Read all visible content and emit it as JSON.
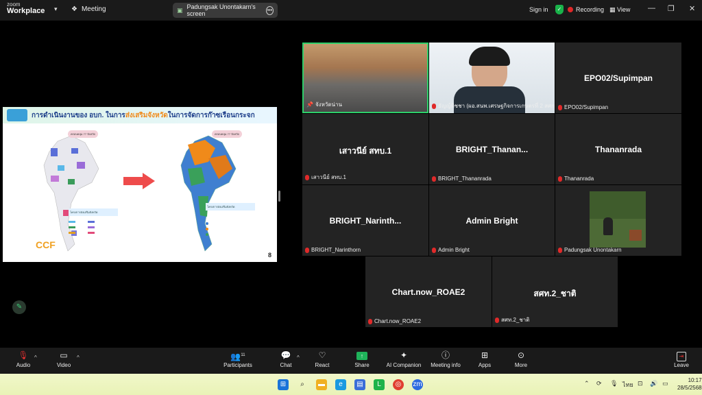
{
  "app": {
    "logo_line1": "zoom",
    "logo_line2": "Workplace",
    "meeting_label": "Meeting"
  },
  "share_banner": {
    "text": "Padungsak Unontakarn's screen"
  },
  "topbar": {
    "sign_in": "Sign in",
    "recording": "Recording",
    "view": "View"
  },
  "slide": {
    "title_pre": "การดำเนินงานของ อบก. ในการ",
    "title_hl": "ส่งเสริมจังหวัด",
    "title_post": "ในการจัดการก๊าซเรือนกระจก",
    "left_pill": "ครอบคลุม 77 จังหวัด",
    "right_pill": "ครอบคลุม 77 จังหวัด",
    "left_note": "โครงการส่งเสริมจังหวัด",
    "right_note": "โครงการส่งเสริมจังหวัด",
    "logo_text": "CCF",
    "page_number": "8"
  },
  "tiles": [
    {
      "name": "",
      "label": "จังหวัดน่าน",
      "muted": false,
      "pinned": true
    },
    {
      "name": "",
      "label": "ธัญญ์ทิชชา (ผอ.สนพ.เศรษฐกิจการเกษตรที่ 2 สศก.)",
      "muted": true
    },
    {
      "name": "EPO02/Supimpan",
      "label": "EPO02/Supimpan",
      "muted": true
    },
    {
      "name": "เสาวนีย์ สทบ.1",
      "label": "เสาวนีย์ สทบ.1",
      "muted": true
    },
    {
      "name": "BRIGHT_Thanan...",
      "label": "BRIGHT_Thananrada",
      "muted": true
    },
    {
      "name": "Thananrada",
      "label": "Thananrada",
      "muted": true
    },
    {
      "name": "BRIGHT_Narinth...",
      "label": "BRIGHT_Narinthorn",
      "muted": true
    },
    {
      "name": "Admin Bright",
      "label": "Admin Bright",
      "muted": true
    },
    {
      "name": "",
      "label": "Padungsak Unontakarn",
      "muted": true
    },
    {
      "name": "Chart.now_ROAE2",
      "label": "Chart.now_ROAE2",
      "muted": true
    },
    {
      "name": "สศท.2_ชาติ",
      "label": "สศท.2_ชาติ",
      "muted": true
    }
  ],
  "toolbar": {
    "audio": "Audio",
    "video": "Video",
    "participants": "Participants",
    "participants_count": "11",
    "chat": "Chat",
    "react": "React",
    "share": "Share",
    "ai": "AI Companion",
    "meeting_info": "Meeting info",
    "apps": "Apps",
    "more": "More",
    "leave": "Leave"
  },
  "taskbar": {
    "lang": "ไทย",
    "time": "10:17",
    "date": "28/5/2568"
  },
  "colors": {
    "accent_green": "#1fb35a",
    "record_red": "#e02828",
    "tile_bg": "#232323"
  }
}
